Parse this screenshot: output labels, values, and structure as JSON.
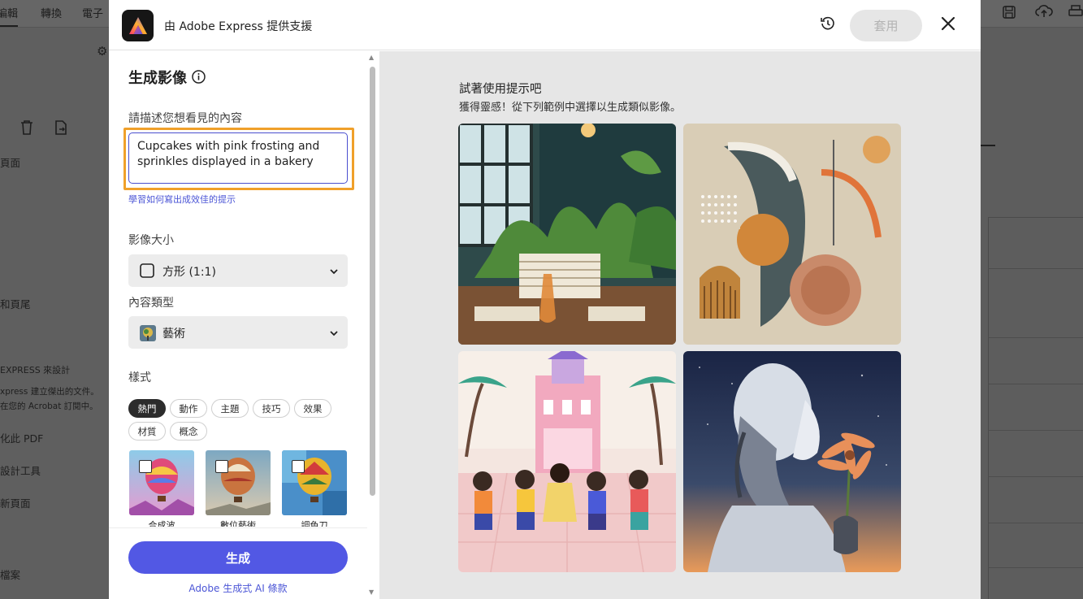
{
  "background": {
    "tabs": [
      "編輯",
      "轉換",
      "電子"
    ],
    "sidebar_texts": [
      "頁面",
      "和頁尾",
      "EXPRESS 來設計",
      "xpress 建立傑出的文件。",
      "在您的 Acrobat 訂閱中。",
      "化此 PDF",
      "設計工具",
      "新頁面",
      "檔案"
    ]
  },
  "header": {
    "title": "由 Adobe Express 提供支援",
    "apply_label": "套用"
  },
  "left_panel": {
    "heading": "生成影像",
    "prompt_label": "請描述您想看見的內容",
    "prompt_value": "Cupcakes with pink frosting and sprinkles displayed in a bakery",
    "prompt_help_link": "學習如何寫出成效佳的提示",
    "size_label": "影像大小",
    "size_value": "方形 (1:1)",
    "content_type_label": "內容類型",
    "content_type_value": "藝術",
    "style_label": "樣式",
    "style_chips": [
      "熱門",
      "動作",
      "主題",
      "技巧",
      "效果",
      "材質",
      "概念"
    ],
    "style_thumbnails": [
      "合成波",
      "數位藝術",
      "調色刀"
    ],
    "generate_label": "生成",
    "terms_link": "Adobe 生成式 AI 條款"
  },
  "right_panel": {
    "title": "試著使用提示吧",
    "subtitle": "獲得靈感！從下列範例中選擇以生成類似影像。"
  },
  "colors": {
    "accent": "#5258e4",
    "focus_outline": "#f0a02a",
    "selected_chip": "#2c2c2c"
  }
}
